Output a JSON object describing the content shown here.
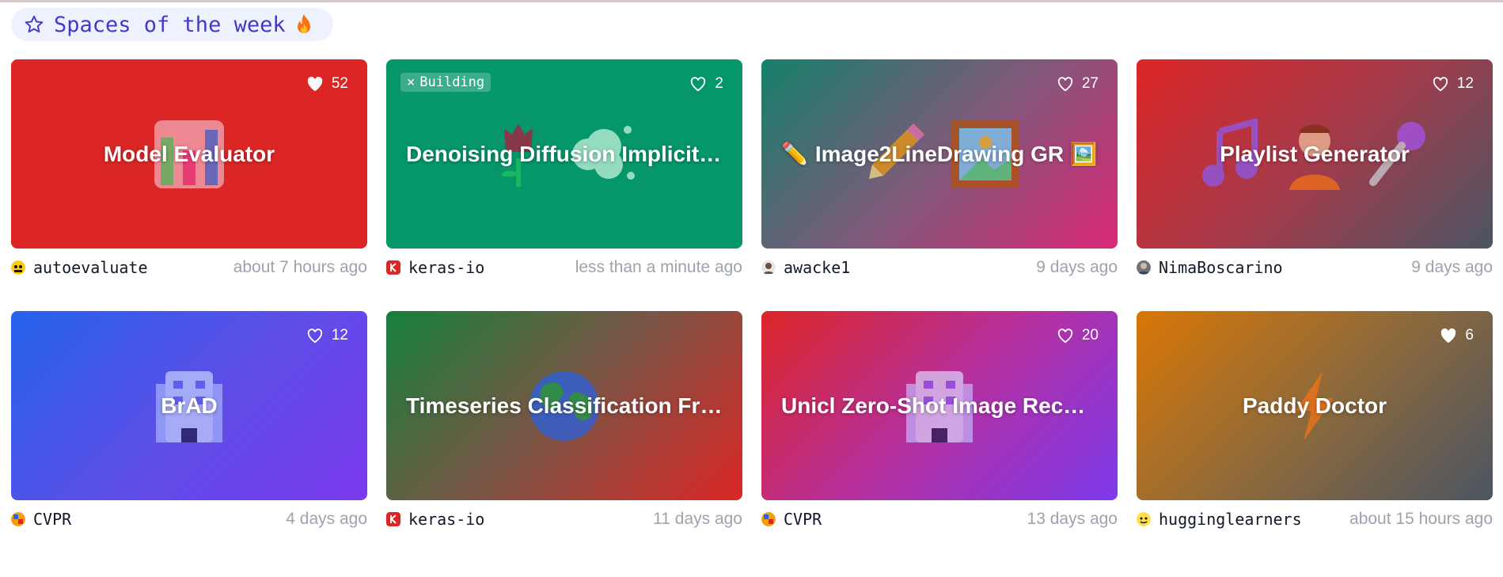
{
  "header": {
    "title": "Spaces of the week"
  },
  "cards": [
    {
      "title": "Model Evaluator",
      "likes": "52",
      "status": "",
      "author": "autoevaluate",
      "time": "about 7 hours ago",
      "icon": "bar-chart-icon"
    },
    {
      "title": "Denoising Diffusion Implicit Mo...",
      "likes": "2",
      "status": "Building",
      "author": "keras-io",
      "time": "less than a minute ago",
      "icon": "flower-cloud-icon"
    },
    {
      "title": "✏️ Image2LineDrawing GR 🖼️",
      "likes": "27",
      "status": "",
      "author": "awacke1",
      "time": "9 days ago",
      "icon": "pencil-picture-icon"
    },
    {
      "title": "Playlist Generator",
      "likes": "12",
      "status": "",
      "author": "NimaBoscarino",
      "time": "9 days ago",
      "icon": "music-microphone-icon"
    },
    {
      "title": "BrAD",
      "likes": "12",
      "status": "",
      "author": "CVPR",
      "time": "4 days ago",
      "icon": "building-icon"
    },
    {
      "title": "Timeseries Classification From ...",
      "likes": "",
      "status": "",
      "author": "keras-io",
      "time": "11 days ago",
      "icon": "globe-icon"
    },
    {
      "title": "Unicl Zero-Shot Image Recognit...",
      "likes": "20",
      "status": "",
      "author": "CVPR",
      "time": "13 days ago",
      "icon": "building-icon"
    },
    {
      "title": "Paddy Doctor",
      "likes": "6",
      "status": "",
      "author": "hugginglearners",
      "time": "about 15 hours ago",
      "icon": "lightning-icon"
    }
  ],
  "colors": {
    "accent": "#4338ca",
    "muted": "#9ca3af"
  }
}
